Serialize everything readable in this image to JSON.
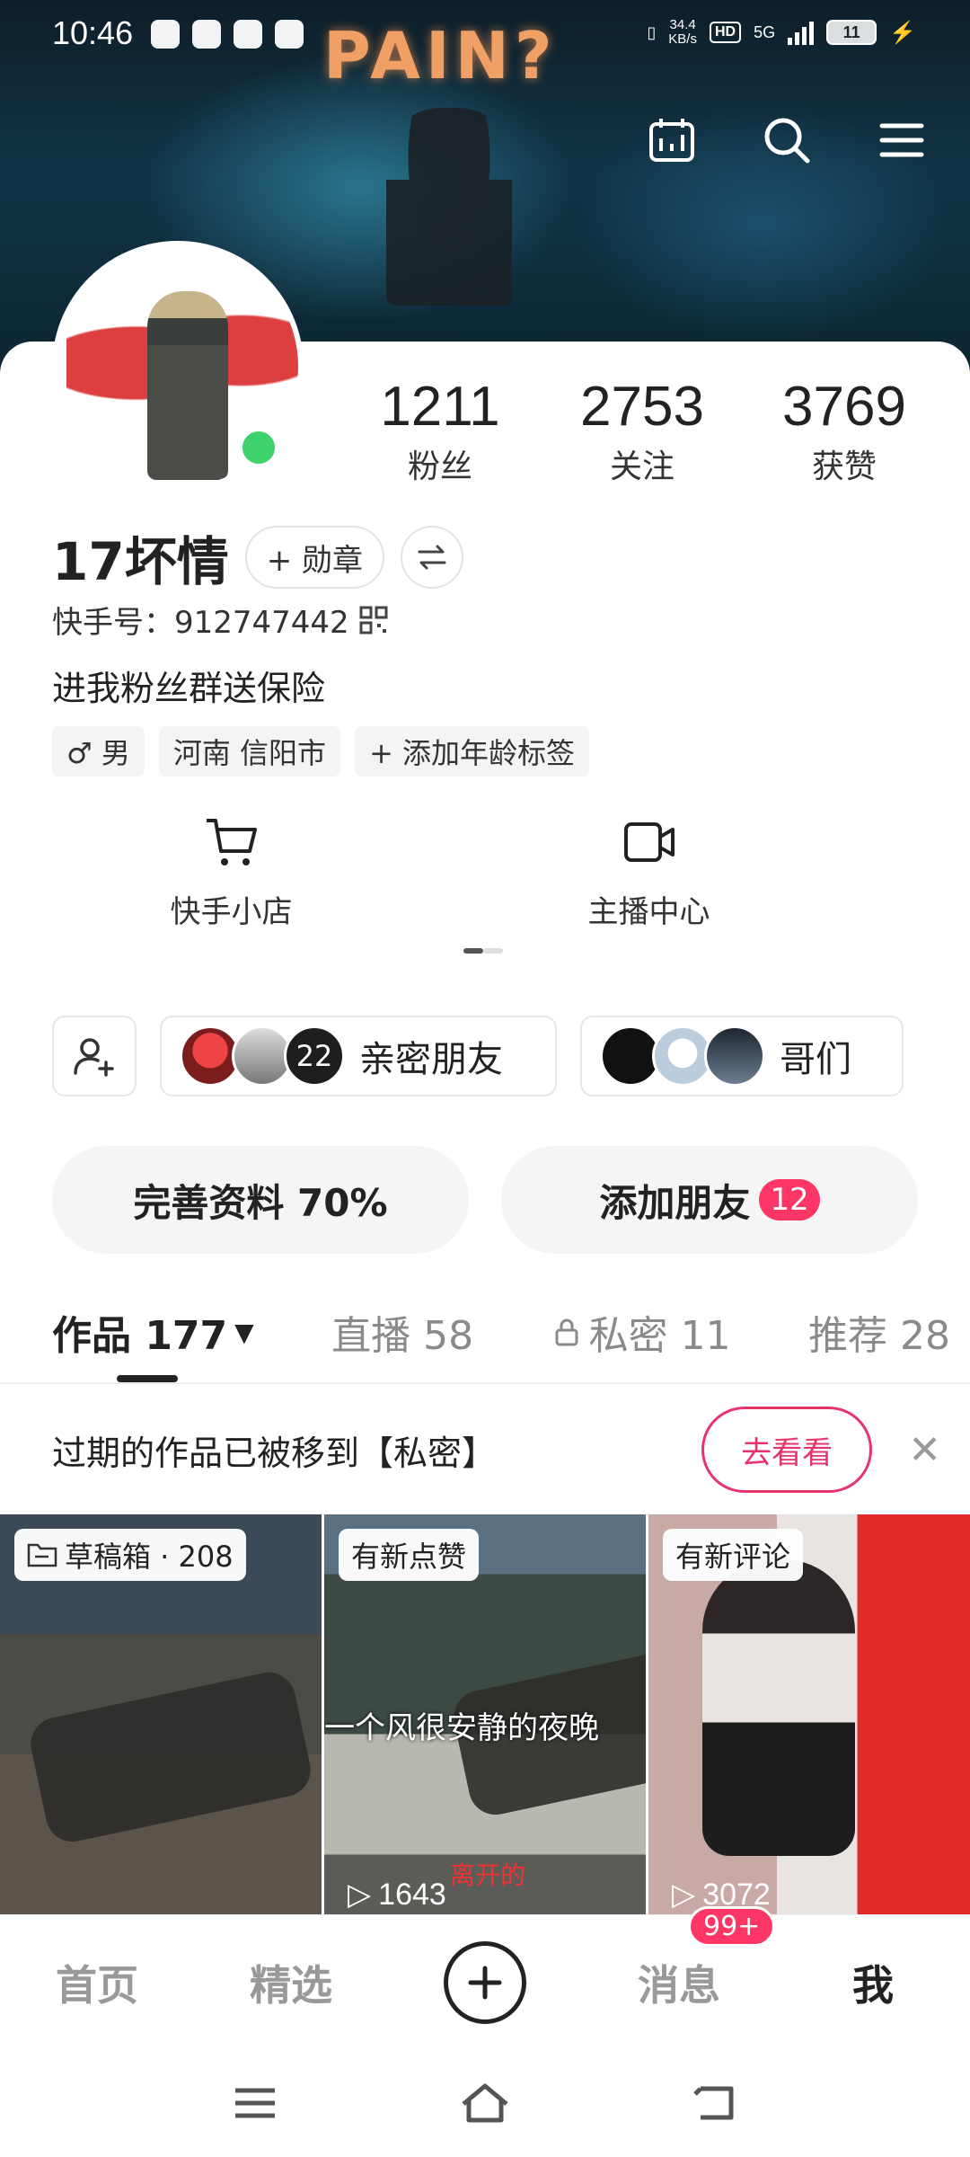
{
  "status_bar": {
    "time": "10:46",
    "net_speed": "34.4\nKB/s",
    "hd": "HD",
    "network": "5G",
    "battery": "11"
  },
  "banner": {
    "neon_text": "PAIN?"
  },
  "header_icons": [
    "calendar-icon",
    "search-icon",
    "menu-icon"
  ],
  "profile": {
    "stats": [
      {
        "value": "1211",
        "label": "粉丝"
      },
      {
        "value": "2753",
        "label": "关注"
      },
      {
        "value": "3769",
        "label": "获赞"
      }
    ],
    "name": "17坏情",
    "medal_button": "+ 勋章",
    "kuaishou_id": "快手号：912747442",
    "bio": "进我粉丝群送保险",
    "tags": [
      "♂ 男",
      "河南 信阳市",
      "+ 添加年龄标签"
    ]
  },
  "shortcuts": [
    {
      "label": "快手小店",
      "icon": "cart-icon"
    },
    {
      "label": "主播中心",
      "icon": "camera-icon"
    }
  ],
  "friend_groups": [
    {
      "label": "亲密朋友",
      "count_overlay": "22"
    },
    {
      "label": "哥们"
    }
  ],
  "actions": {
    "complete_profile": "完善资料 70%",
    "add_friends": "添加朋友",
    "add_friends_badge": "12"
  },
  "tabs": [
    {
      "label": "作品 177",
      "active": true
    },
    {
      "label": "直播 58",
      "active": false
    },
    {
      "label": "私密 11",
      "active": false
    },
    {
      "label": "推荐 28",
      "active": false
    }
  ],
  "notice": {
    "text": "过期的作品已被移到【私密】",
    "button": "去看看"
  },
  "grid": [
    {
      "label": "草稿箱 · 208"
    },
    {
      "label": "有新点赞",
      "caption": "一个风很安静的夜晚",
      "caption2": "离开的",
      "plays": "1643"
    },
    {
      "label": "有新评论",
      "plays": "3072"
    }
  ],
  "bottom_nav": {
    "home": "首页",
    "featured": "精选",
    "messages": "消息",
    "messages_badge": "99+",
    "me": "我"
  },
  "colors": {
    "accent": "#fe3666",
    "online": "#3fd16b",
    "notice_button": "#e6336a"
  }
}
